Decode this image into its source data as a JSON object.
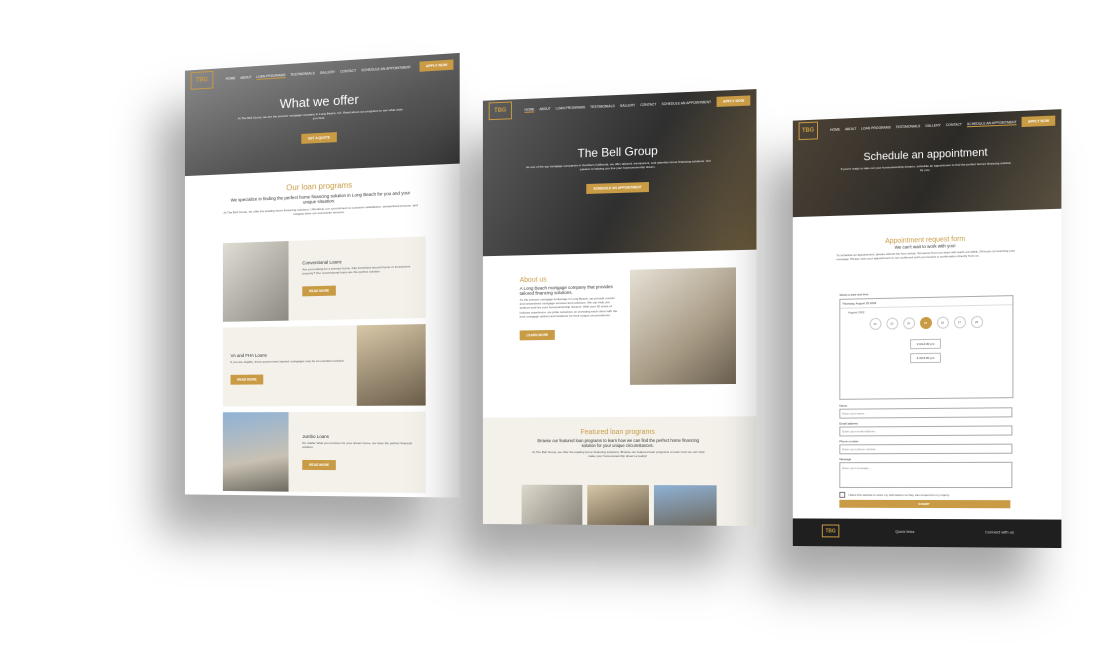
{
  "nav": {
    "logo": "TBG",
    "home": "HOME",
    "about": "ABOUT",
    "loan_programs": "LOAN PROGRAMS",
    "testimonials": "TESTIMONIALS",
    "gallery": "GALLERY",
    "contact": "CONTACT",
    "schedule": "SCHEDULE AN APPOINTMENT",
    "apply": "APPLY NOW"
  },
  "page1": {
    "hero_title": "What we offer",
    "hero_text": "At The Bell Group, we are the premier mortgage company in Long Beach, CA. Read about our programs to see what suits you best.",
    "hero_button": "GET A QUOTE",
    "section_title": "Our loan programs",
    "section_subtitle": "We specialize in finding the perfect home financing solution in Long Beach for you and your unique situation.",
    "section_text": "At The Bell Group, we offer the leading home financing solutions. Ultimately, our commitment to customer satisfaction, streamlined process, and integrity drive our successful services.",
    "loans": [
      {
        "title": "Conventional Loans",
        "text": "Are you looking for a primary home, fully furnished second home or investment property? Our conventional loans are the perfect solution.",
        "button": "READ MORE"
      },
      {
        "title": "VA and FHA Loans",
        "text": "If you are eligible, these government backed mortgages may be an excellent solution.",
        "button": "READ MORE"
      },
      {
        "title": "Jumbo Loans",
        "text": "No matter what you envision for your dream home, we have the perfect financial solution.",
        "button": "READ MORE"
      }
    ]
  },
  "page2": {
    "hero_title": "The Bell Group",
    "hero_text": "As one of the top mortgage companies in Southern California, we offer tailored, transparent, and attentive home financing solutions. Our passion is helping you live your homeownership dream.",
    "hero_button": "SCHEDULE AN APPOINTMENT",
    "about_title": "About us",
    "about_subtitle": "A Long Beach mortgage company that provides tailored financing solutions.",
    "about_text": "As the premier mortgage brokerage in Long Beach, we provide custom and streamlined mortgage services and solutions. We can help you achieve and live your homeownership dreams. With over 20 years of industry experience, we pride ourselves on providing each client with the best mortgage options and solutions for their unique circumstances.",
    "about_button": "LEARN MORE",
    "featured_title": "Featured loan programs",
    "featured_subtitle": "Browse our featured loan programs to learn how we can find the perfect home financing solution for your unique circumstances.",
    "featured_text": "At The Bell Group, we offer the leading home financing solutions. Browse our featured loan programs to learn how we can help make your homeownership dream a reality!"
  },
  "page3": {
    "hero_title": "Schedule an appointment",
    "hero_text": "If you're ready to take out your homeownership dreams, schedule an appointment to find the perfect homes financing solution for you.",
    "form_title": "Appointment request form",
    "form_subtitle": "We can't wait to work with you!",
    "form_text": "To schedule an appointment, please submit the form below. Someone from our team will reach out within 24 hours of receiving your message. Please note your appointment is not confirmed until you receive a confirmation directly from us.",
    "date_label": "Select a date and time",
    "selected_date": "Thursday, August 25 2022",
    "month": "August 2022",
    "days": [
      "22",
      "23",
      "24",
      "25",
      "26",
      "27",
      "28"
    ],
    "times": [
      "2:00-2:30 pm",
      "4:30-5:00 pm"
    ],
    "name_label": "Name",
    "name_placeholder": "Enter your name...",
    "email_label": "Email address",
    "email_placeholder": "Enter your email address...",
    "phone_label": "Phone number",
    "phone_placeholder": "Enter your phone number...",
    "message_label": "Message",
    "message_placeholder": "Enter your message...",
    "consent": "I allow this website to store my submission so they can respond to my inquiry.",
    "submit": "SUBMIT",
    "footer_left": "Quick links",
    "footer_right": "Connect with us"
  },
  "colors": {
    "accent": "#c99b45",
    "dark": "#3b3b3b"
  }
}
